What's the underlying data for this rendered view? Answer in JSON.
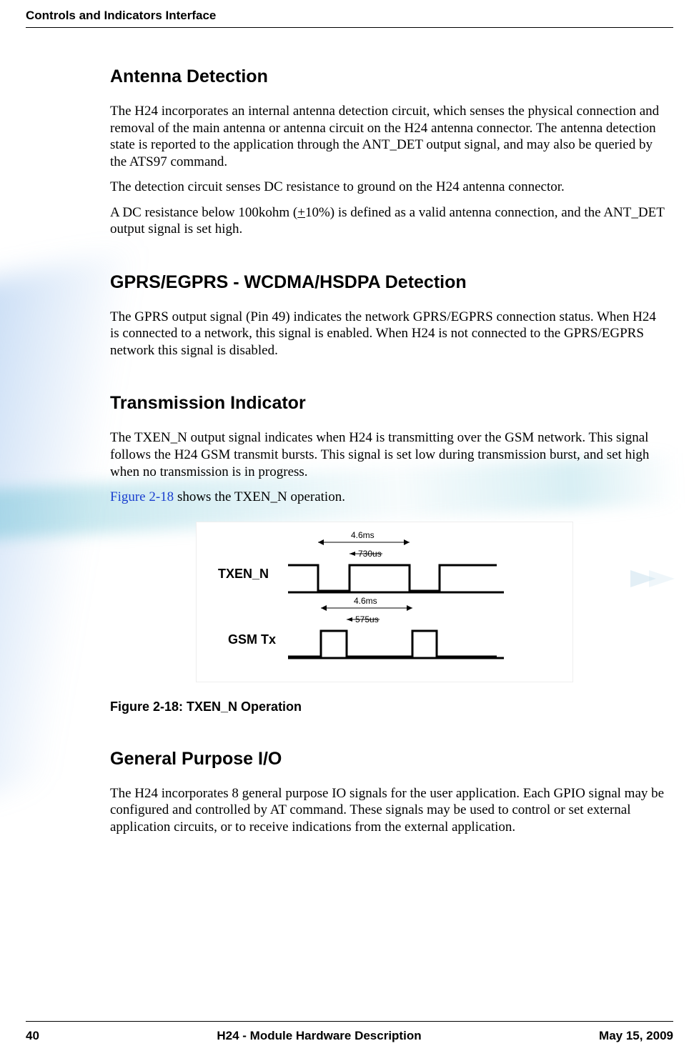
{
  "header": {
    "title": "Controls and Indicators Interface"
  },
  "sections": {
    "antenna": {
      "heading": "Antenna Detection",
      "p1": "The H24 incorporates an internal antenna detection circuit, which senses the physical connection and removal of the main antenna or antenna circuit on the H24 antenna connector. The antenna detection state is reported to the application through the ANT_DET output signal, and may also be queried by the ATS97 command.",
      "p2": "The detection circuit senses DC resistance to ground on the H24 antenna connector.",
      "p3a": "A DC resistance below 100kohm (",
      "p3b": "+",
      "p3c": "10%) is defined as a valid antenna connection, and the ANT_DET output signal is set high."
    },
    "gprs": {
      "heading": "GPRS/EGPRS - WCDMA/HSDPA Detection",
      "p1": "The GPRS output signal (Pin 49) indicates the network GPRS/EGPRS connection status. When H24 is connected to a network, this signal is enabled. When H24 is not connected to the GPRS/EGPRS network this signal is disabled."
    },
    "tx": {
      "heading": "Transmission Indicator",
      "p1": "The TXEN_N output signal indicates when H24 is transmitting over the GSM network. This signal follows the H24 GSM transmit bursts. This signal is set low during transmission burst, and set high when no transmission is in progress.",
      "p2_link": "Figure 2-18",
      "p2_rest": " shows the TXEN_N operation.",
      "figure_caption": "Figure 2-18: TXEN_N Operation",
      "fig": {
        "txen_label": "TXEN_N",
        "gsm_label": "GSM Tx",
        "t_top_ms": "4.6ms",
        "t_top_us": "730us",
        "t_bot_ms": "4.6ms",
        "t_bot_us": "575us"
      }
    },
    "gpio": {
      "heading": "General Purpose I/O",
      "p1": "The H24 incorporates 8 general purpose IO signals for the user application. Each GPIO signal may be configured and controlled by AT command. These signals may be used to control or set external application circuits, or to receive indications from the external application."
    }
  },
  "footer": {
    "page": "40",
    "doc_title": "H24 - Module Hardware Description",
    "date": "May 15, 2009"
  }
}
